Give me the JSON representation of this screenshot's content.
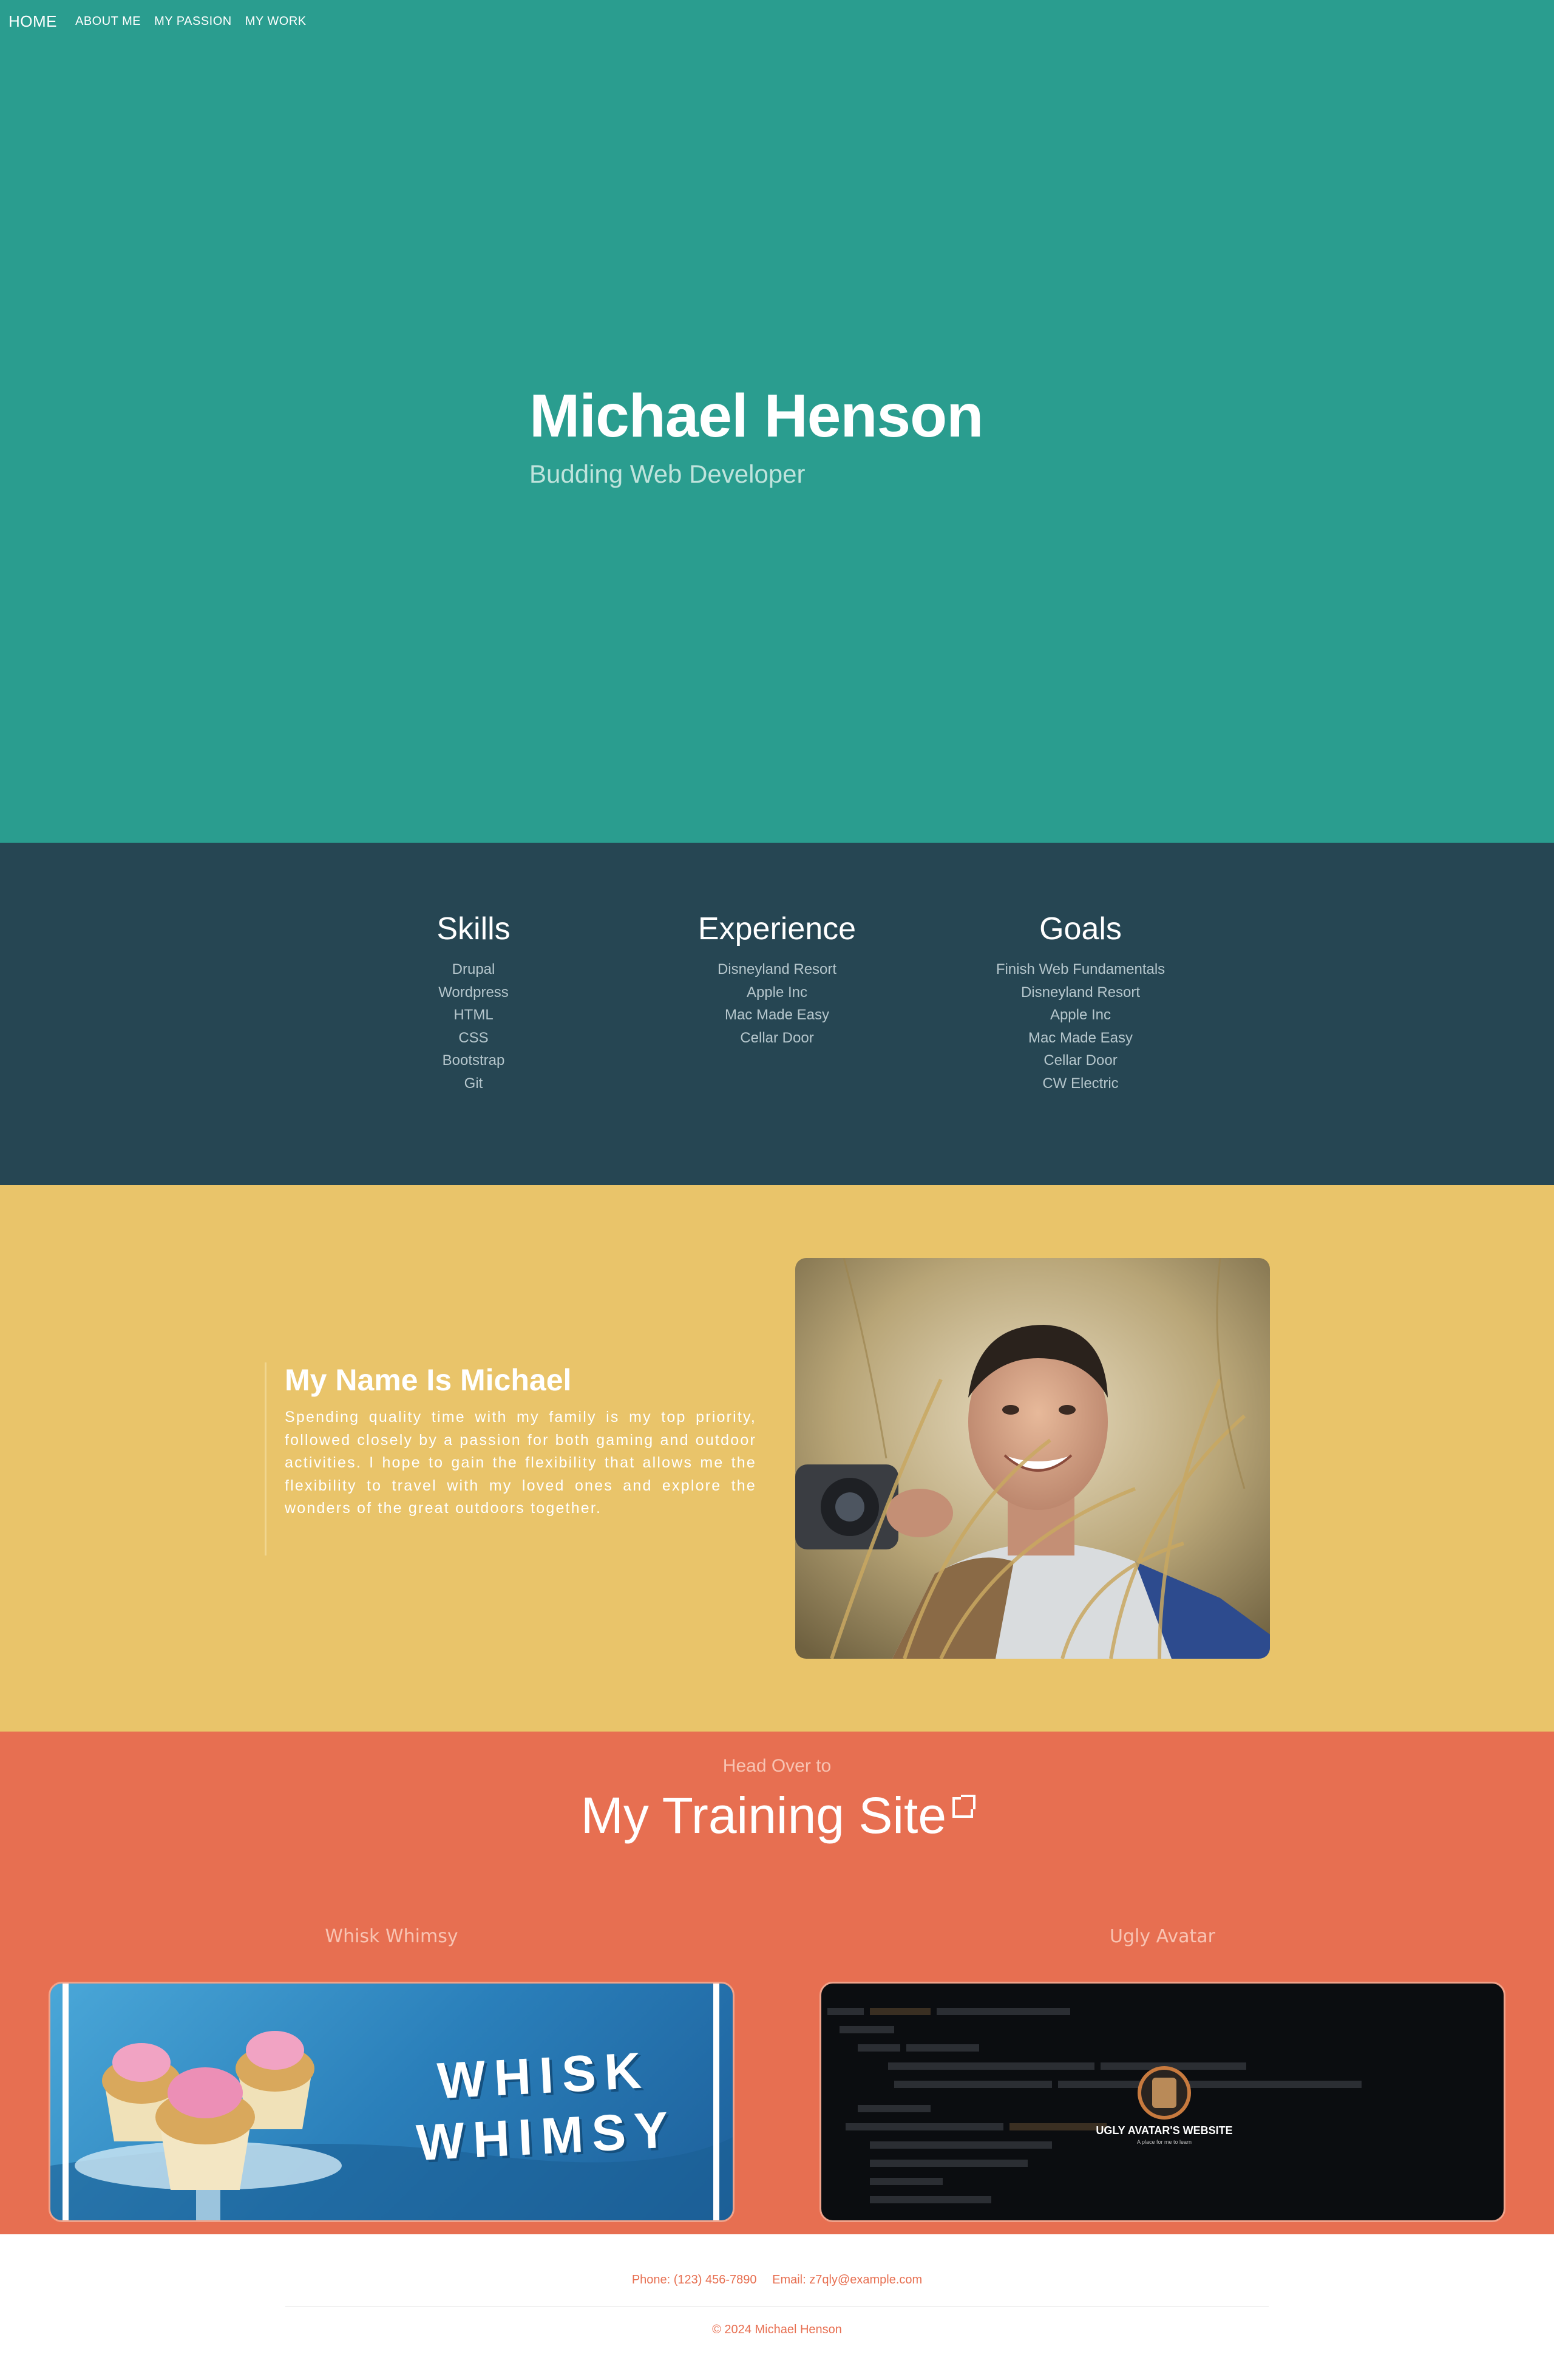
{
  "nav": {
    "items": [
      "HOME",
      "ABOUT ME",
      "MY PASSION",
      "MY WORK"
    ]
  },
  "hero": {
    "name": "Michael Henson",
    "subtitle": "Budding Web Developer"
  },
  "skills": {
    "columns": [
      {
        "heading": "Skills",
        "items": [
          "Drupal",
          "Wordpress",
          "HTML",
          "CSS",
          "Bootstrap",
          "Git"
        ]
      },
      {
        "heading": "Experience",
        "items": [
          "Disneyland Resort",
          "Apple Inc",
          "Mac Made Easy",
          "Cellar Door"
        ]
      },
      {
        "heading": "Goals",
        "items": [
          "Finish Web Fundamentals",
          "Disneyland Resort",
          "Apple Inc",
          "Mac Made Easy",
          "Cellar Door",
          "CW Electric"
        ]
      }
    ]
  },
  "about": {
    "heading": "My Name Is Michael",
    "body": "Spending quality time with my family is my top priority, followed closely by a passion for both gaming and outdoor activities. I hope to gain the flexibility that allows me the flexibility to travel with my loved ones and explore the wonders of the great outdoors together."
  },
  "training": {
    "kicker": "Head Over to",
    "title": "My Training Site",
    "projects": [
      {
        "title": "Whisk Whimsy",
        "logo_line1": "WHISK",
        "logo_line2": "WHIMSY"
      },
      {
        "title": "Ugly Avatar",
        "logo_title": "UGLY AVATAR'S WEBSITE",
        "logo_tagline": "A place for me to learn"
      }
    ]
  },
  "footer": {
    "phone": "Phone: (123) 456-7890",
    "email": "Email: z7qly@example.com",
    "copyright": "© 2024 Michael Henson"
  },
  "colors": {
    "hero_bg": "#2a9d8f",
    "skills_bg": "#264653",
    "about_bg": "#e9c46a",
    "training_bg": "#e76f51",
    "footer_text": "#e76f51"
  },
  "icons": {
    "external_link": "external-link-icon"
  }
}
